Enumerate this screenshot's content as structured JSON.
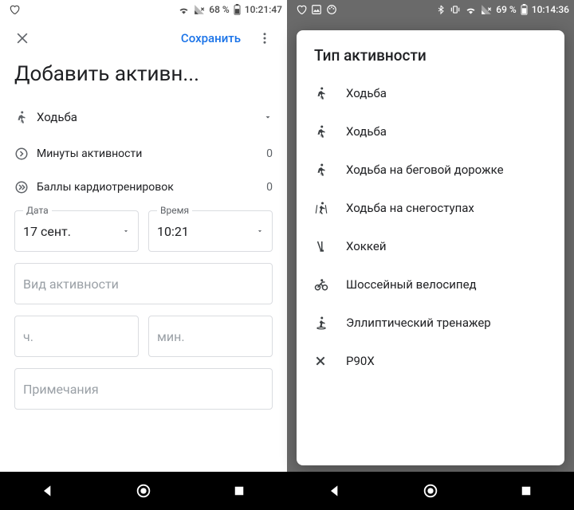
{
  "left": {
    "status": {
      "battery": "68 %",
      "time": "10:21:47"
    },
    "save_label": "Сохранить",
    "title": "Добавить активн...",
    "activity_type": "Ходьба",
    "metrics": {
      "minutes_label": "Минуты активности",
      "minutes_value": "0",
      "cardio_label": "Баллы кардиотренировок",
      "cardio_value": "0"
    },
    "date_label": "Дата",
    "date_value": "17 сент.",
    "time_label": "Время",
    "time_value": "10:21",
    "activity_placeholder": "Вид активности",
    "hours_placeholder": "ч.",
    "mins_placeholder": "мин.",
    "notes_placeholder": "Примечания"
  },
  "right": {
    "status": {
      "battery": "69 %",
      "time": "10:14:36"
    },
    "sheet_title": "Тип активности",
    "items": [
      {
        "icon": "walk",
        "label": "Ходьба"
      },
      {
        "icon": "walk",
        "label": "Ходьба"
      },
      {
        "icon": "walk",
        "label": "Ходьба на беговой дорожке"
      },
      {
        "icon": "ski",
        "label": "Ходьба на снегоступах"
      },
      {
        "icon": "hockey",
        "label": "Хоккей"
      },
      {
        "icon": "bike",
        "label": "Шоссейный велосипед"
      },
      {
        "icon": "ellip",
        "label": "Эллиптический тренажер"
      },
      {
        "icon": "x",
        "label": "P90X"
      }
    ]
  }
}
